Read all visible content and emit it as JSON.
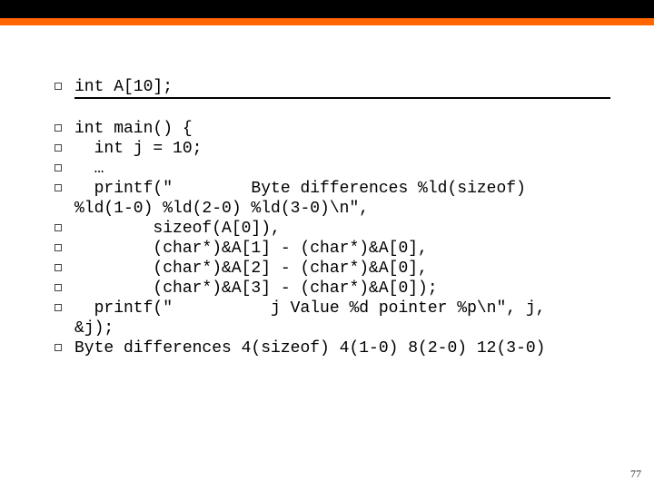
{
  "code_lines": {
    "declaration": "int A[10];",
    "l1": "int main() {",
    "l2": "  int j = 10;",
    "l3": "  …",
    "l4a": "  printf(\"        Byte differences %ld(sizeof)",
    "l4b": "%ld(1-0) %ld(2-0) %ld(3-0)\\n\",",
    "l5": "        sizeof(A[0]),",
    "l6": "        (char*)&A[1] - (char*)&A[0],",
    "l7": "        (char*)&A[2] - (char*)&A[0],",
    "l8": "        (char*)&A[3] - (char*)&A[0]);",
    "l9a": "  printf(\"          j Value %d pointer %p\\n\", j,",
    "l9b": "&j);",
    "l10": "Byte differences 4(sizeof) 4(1-0) 8(2-0) 12(3-0)"
  },
  "page_number": "77"
}
